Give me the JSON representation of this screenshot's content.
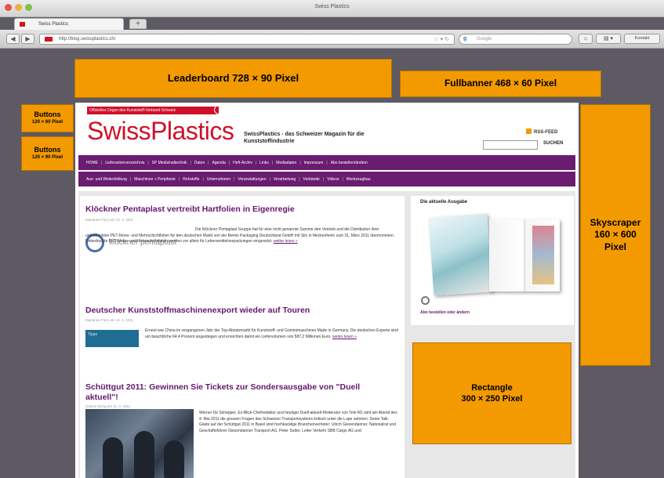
{
  "browser": {
    "window_title": "Swiss Plastics",
    "tab_label": "Swiss Plastics",
    "url": "http://blog.swissplastics.ch/",
    "search_placeholder": "Google",
    "extra_button": "Kontakt"
  },
  "ads": {
    "leaderboard": "Leaderboard 728 × 90 Pixel",
    "fullbanner": "Fullbanner 468 × 60 Pixel",
    "buttons_1": {
      "title": "Buttons",
      "size": "120 × 60 Pixel"
    },
    "buttons_2": {
      "title": "Buttons",
      "size": "120 × 90 Pixel"
    },
    "skyscraper": {
      "line1": "Skyscraper",
      "line2": "160 × 600",
      "line3": "Pixel"
    },
    "rectangle": {
      "line1": "Rectangle",
      "line2": "300 × 250 Pixel"
    },
    "color": "#f29a00"
  },
  "site": {
    "ribbon": "Offizielles Organ des Kunststoff-Verband Schweiz",
    "logo": "SwissPlastics",
    "tagline": "SwissPlastics - das Schweizer Magazin für die Kunststoffindustrie",
    "rss": "RSS-FEED",
    "search_button": "SUCHEN",
    "accent": "#6a1c70",
    "logo_color": "#d0102a",
    "nav1": [
      "HOME",
      "Lieferantenverzeichnis",
      "SP Medizinaltechnik",
      "Daten",
      "Agenda",
      "Heft-Archiv",
      "Links",
      "Mediadaten",
      "Impressum",
      "Abo bestellen/ändern"
    ],
    "nav2": [
      "Aus- und Weiterbildung",
      "Maschinen + Peripherie",
      "Rohstoffe",
      "Unternehmen",
      "Veranstaltungen",
      "Verarbeitung",
      "Verbände",
      "Videos",
      "Werkzeugbau"
    ]
  },
  "articles": [
    {
      "title": "Klöckner Pentaplast vertreibt Hartfolien in Eigenregie",
      "meta": "Marianne Flury am 12. 4. 2011",
      "logo_text": "klöckner pentaplast",
      "body": "Die Klöckner Pentaplast Gruppe hat für eine nicht genannte Summe den Vertrieb und die Distribution ihrer unbedruckten PET-Mono- und Mehrschichtfolien für den deutschen Markt von der Bemis Packaging Deutschland GmbH mit Sitz in Meckenheim zum 31. März 2011 übernommen. Unbedruckte PET-Mono- und Mehrschichtfolien werden vor allem für Lebensmittelverpackungen eingesetzt.",
      "more": "weiter lesen »"
    },
    {
      "title": "Deutscher Kunststoffmaschinenexport wieder auf Touren",
      "meta": "Marianne Flury am 12. 4. 2011",
      "thumb": "Tipps",
      "body": "Erneut war China im vergangenen Jahr der Top-Absatzmarkt für Kunststoff- und Gummimaschinen Made in Germany. Die deutschen Exporte sind um beachtliche 64,4 Prozent angestiegen und erreichten damit ein Liefervolumen von 587,2 Millionen Euro.",
      "more": "weiter lesen »"
    },
    {
      "title": "Schüttgut 2011: Gewinnen Sie Tickets zur Sondersausgabe von \"Duell aktuell\"!",
      "meta": "Gaston Dörig am 11. 4. 2011",
      "body": "Werner De Schepper, Ex-Blick-Chefredaktor und heutiger Duell-aktuell-Moderator von Tele M1 wird am Abend des 4. Mai 2011 die grossen Fragen des Schweizer Transportsystems kritisch unter die Lupe nehmen. Seine Talk-Gäste auf der Schüttgut 2011 in Basel sind hochkarätige Branchenvertreter: Ulrich Giezendanner, Nationalrat und Geschäftsführer Giezendanner Transport AG; Peter Sutter, Leiter Verkehr SBB Cargo AG und"
    }
  ],
  "sidebar": {
    "heading": "Die aktuelle Ausgabe",
    "link": "Abo bestellen oder ändern"
  }
}
